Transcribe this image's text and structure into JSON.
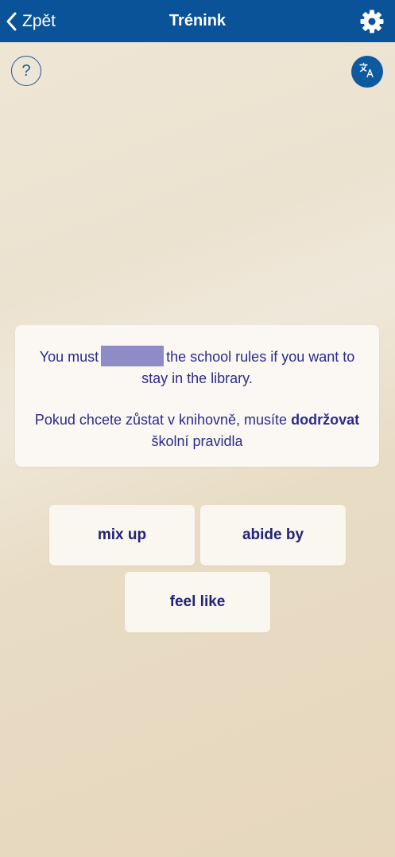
{
  "header": {
    "back_label": "Zpět",
    "title": "Trénink",
    "background": "#0a5398"
  },
  "icons": {
    "back": "chevron-left-icon",
    "settings": "gear-icon",
    "help": "question-mark-icon",
    "translate": "translate-icon"
  },
  "help": {
    "label": "?"
  },
  "exercise": {
    "sentence_before": "You must",
    "sentence_after": "the school rules if you want to stay in the library.",
    "translation_before": "Pokud chcete zůstat v knihovně, musíte",
    "translation_bold": "dodržovat",
    "translation_after": "školní pravidla",
    "text_color": "#2b2a8c",
    "blank_color": "#8e8bc6"
  },
  "options": [
    {
      "label": "mix up"
    },
    {
      "label": "abide by"
    },
    {
      "label": "feel like"
    }
  ]
}
